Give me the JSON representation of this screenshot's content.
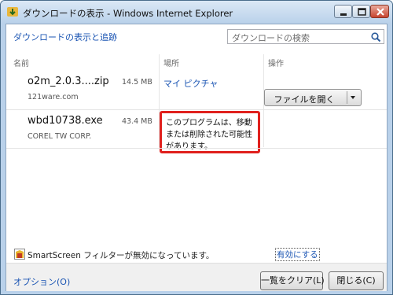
{
  "window": {
    "title": "ダウンロードの表示 - Windows Internet Explorer",
    "controls": {
      "minimize": "minimize",
      "maximize": "maximize",
      "close": "close"
    }
  },
  "header": {
    "view_link": "ダウンロードの表示と追跡",
    "search_placeholder": "ダウンロードの検索"
  },
  "columns": {
    "name": "名前",
    "location": "場所",
    "actions": "操作"
  },
  "downloads": [
    {
      "file": "o2m_2.0.3....zip",
      "size": "14.5 MB",
      "publisher": "121ware.com",
      "location_link": "マイ ピクチャ",
      "action_label": "ファイルを開く"
    },
    {
      "file": "wbd10738.exe",
      "size": "43.4 MB",
      "publisher": "COREL TW CORP.",
      "warning": "このプログラムは、移動または削除された可能性があります。"
    }
  ],
  "smartscreen": {
    "status": "SmartScreen フィルターが無効になっています。",
    "enable_link": "有効にする"
  },
  "footer": {
    "options_link": "オプション(O)",
    "clear_button": "一覧をクリア(L)",
    "close_button": "閉じる(C)"
  },
  "colors": {
    "link": "#1b55b3",
    "warning_border": "#e0201d",
    "frame": "#b9d1ea"
  }
}
